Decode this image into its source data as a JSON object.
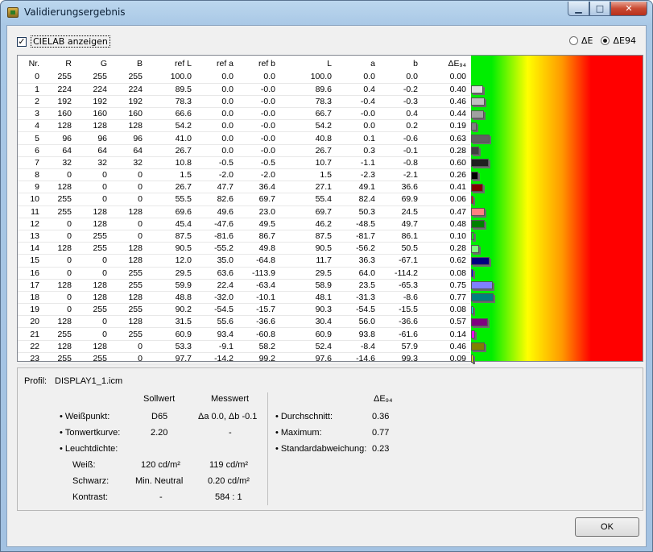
{
  "window": {
    "title": "Validierungsergebnis"
  },
  "options": {
    "show_cielab": "CIELAB anzeigen",
    "radio_de": "ΔE",
    "radio_de94": "ΔE94"
  },
  "table": {
    "headers": [
      "Nr.",
      "R",
      "G",
      "B",
      "ref L",
      "ref a",
      "ref b",
      "L",
      "a",
      "b",
      "ΔE₉₄"
    ],
    "rows": [
      [
        "0",
        "255",
        "255",
        "255",
        "100.0",
        "0.0",
        "0.0",
        "100.0",
        "0.0",
        "0.0",
        "0.00"
      ],
      [
        "1",
        "224",
        "224",
        "224",
        "89.5",
        "0.0",
        "-0.0",
        "89.6",
        "0.4",
        "-0.2",
        "0.40"
      ],
      [
        "2",
        "192",
        "192",
        "192",
        "78.3",
        "0.0",
        "-0.0",
        "78.3",
        "-0.4",
        "-0.3",
        "0.46"
      ],
      [
        "3",
        "160",
        "160",
        "160",
        "66.6",
        "0.0",
        "-0.0",
        "66.7",
        "-0.0",
        "0.4",
        "0.44"
      ],
      [
        "4",
        "128",
        "128",
        "128",
        "54.2",
        "0.0",
        "-0.0",
        "54.2",
        "0.0",
        "0.2",
        "0.19"
      ],
      [
        "5",
        "96",
        "96",
        "96",
        "41.0",
        "0.0",
        "-0.0",
        "40.8",
        "0.1",
        "-0.6",
        "0.63"
      ],
      [
        "6",
        "64",
        "64",
        "64",
        "26.7",
        "0.0",
        "-0.0",
        "26.7",
        "0.3",
        "-0.1",
        "0.28"
      ],
      [
        "7",
        "32",
        "32",
        "32",
        "10.8",
        "-0.5",
        "-0.5",
        "10.7",
        "-1.1",
        "-0.8",
        "0.60"
      ],
      [
        "8",
        "0",
        "0",
        "0",
        "1.5",
        "-2.0",
        "-2.0",
        "1.5",
        "-2.3",
        "-2.1",
        "0.26"
      ],
      [
        "9",
        "128",
        "0",
        "0",
        "26.7",
        "47.7",
        "36.4",
        "27.1",
        "49.1",
        "36.6",
        "0.41"
      ],
      [
        "10",
        "255",
        "0",
        "0",
        "55.5",
        "82.6",
        "69.7",
        "55.4",
        "82.4",
        "69.9",
        "0.06"
      ],
      [
        "11",
        "255",
        "128",
        "128",
        "69.6",
        "49.6",
        "23.0",
        "69.7",
        "50.3",
        "24.5",
        "0.47"
      ],
      [
        "12",
        "0",
        "128",
        "0",
        "45.4",
        "-47.6",
        "49.5",
        "46.2",
        "-48.5",
        "49.7",
        "0.48"
      ],
      [
        "13",
        "0",
        "255",
        "0",
        "87.5",
        "-81.6",
        "86.7",
        "87.5",
        "-81.7",
        "86.1",
        "0.10"
      ],
      [
        "14",
        "128",
        "255",
        "128",
        "90.5",
        "-55.2",
        "49.8",
        "90.5",
        "-56.2",
        "50.5",
        "0.28"
      ],
      [
        "15",
        "0",
        "0",
        "128",
        "12.0",
        "35.0",
        "-64.8",
        "11.7",
        "36.3",
        "-67.1",
        "0.62"
      ],
      [
        "16",
        "0",
        "0",
        "255",
        "29.5",
        "63.6",
        "-113.9",
        "29.5",
        "64.0",
        "-114.2",
        "0.08"
      ],
      [
        "17",
        "128",
        "128",
        "255",
        "59.9",
        "22.4",
        "-63.4",
        "58.9",
        "23.5",
        "-65.3",
        "0.75"
      ],
      [
        "18",
        "0",
        "128",
        "128",
        "48.8",
        "-32.0",
        "-10.1",
        "48.1",
        "-31.3",
        "-8.6",
        "0.77"
      ],
      [
        "19",
        "0",
        "255",
        "255",
        "90.2",
        "-54.5",
        "-15.7",
        "90.3",
        "-54.5",
        "-15.5",
        "0.08"
      ],
      [
        "20",
        "128",
        "0",
        "128",
        "31.5",
        "55.6",
        "-36.6",
        "30.4",
        "56.0",
        "-36.6",
        "0.57"
      ],
      [
        "21",
        "255",
        "0",
        "255",
        "60.9",
        "93.4",
        "-60.8",
        "60.9",
        "93.8",
        "-61.6",
        "0.14"
      ],
      [
        "22",
        "128",
        "128",
        "0",
        "53.3",
        "-9.1",
        "58.2",
        "52.4",
        "-8.4",
        "57.9",
        "0.46"
      ],
      [
        "23",
        "255",
        "255",
        "0",
        "97.7",
        "-14.2",
        "99.2",
        "97.6",
        "-14.6",
        "99.3",
        "0.09"
      ]
    ]
  },
  "summary": {
    "profile_label": "Profil:",
    "profile_name": "DISPLAY1_1.icm",
    "col_soll": "Sollwert",
    "col_mess": "Messwert",
    "col_de": "ΔE₉₄",
    "whitepoint_label": "Weißpunkt:",
    "whitepoint_soll": "D65",
    "whitepoint_mess": "Δa 0.0, Δb -0.1",
    "tone_label": "Tonwertkurve:",
    "tone_soll": "2.20",
    "tone_mess": "-",
    "lum_label": "Leuchtdichte:",
    "white_label": "Weiß:",
    "white_soll": "120 cd/m²",
    "white_mess": "119 cd/m²",
    "black_label": "Schwarz:",
    "black_soll": "Min. Neutral",
    "black_mess": "0.20 cd/m²",
    "contrast_label": "Kontrast:",
    "contrast_soll": "-",
    "contrast_mess": "584 : 1",
    "avg_label": "Durchschnitt:",
    "avg_value": "0.36",
    "max_label": "Maximum:",
    "max_value": "0.77",
    "std_label": "Standardabweichung:",
    "std_value": "0.23"
  },
  "buttons": {
    "ok": "OK"
  },
  "colors": {
    "scale_green": "#00ee00",
    "scale_yellow": "#ffff00",
    "scale_red": "#ff0000"
  }
}
